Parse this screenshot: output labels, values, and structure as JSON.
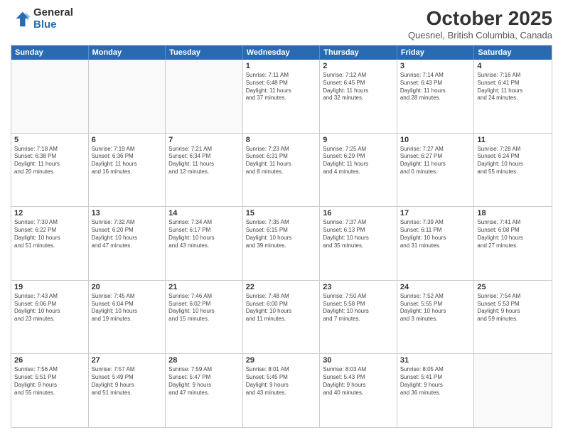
{
  "header": {
    "logo_general": "General",
    "logo_blue": "Blue",
    "month": "October 2025",
    "location": "Quesnel, British Columbia, Canada"
  },
  "days_of_week": [
    "Sunday",
    "Monday",
    "Tuesday",
    "Wednesday",
    "Thursday",
    "Friday",
    "Saturday"
  ],
  "weeks": [
    [
      {
        "day": "",
        "info": ""
      },
      {
        "day": "",
        "info": ""
      },
      {
        "day": "",
        "info": ""
      },
      {
        "day": "1",
        "info": "Sunrise: 7:11 AM\nSunset: 6:48 PM\nDaylight: 11 hours\nand 37 minutes."
      },
      {
        "day": "2",
        "info": "Sunrise: 7:12 AM\nSunset: 6:45 PM\nDaylight: 11 hours\nand 32 minutes."
      },
      {
        "day": "3",
        "info": "Sunrise: 7:14 AM\nSunset: 6:43 PM\nDaylight: 11 hours\nand 28 minutes."
      },
      {
        "day": "4",
        "info": "Sunrise: 7:16 AM\nSunset: 6:41 PM\nDaylight: 11 hours\nand 24 minutes."
      }
    ],
    [
      {
        "day": "5",
        "info": "Sunrise: 7:18 AM\nSunset: 6:38 PM\nDaylight: 11 hours\nand 20 minutes."
      },
      {
        "day": "6",
        "info": "Sunrise: 7:19 AM\nSunset: 6:36 PM\nDaylight: 11 hours\nand 16 minutes."
      },
      {
        "day": "7",
        "info": "Sunrise: 7:21 AM\nSunset: 6:34 PM\nDaylight: 11 hours\nand 12 minutes."
      },
      {
        "day": "8",
        "info": "Sunrise: 7:23 AM\nSunset: 6:31 PM\nDaylight: 11 hours\nand 8 minutes."
      },
      {
        "day": "9",
        "info": "Sunrise: 7:25 AM\nSunset: 6:29 PM\nDaylight: 11 hours\nand 4 minutes."
      },
      {
        "day": "10",
        "info": "Sunrise: 7:27 AM\nSunset: 6:27 PM\nDaylight: 11 hours\nand 0 minutes."
      },
      {
        "day": "11",
        "info": "Sunrise: 7:28 AM\nSunset: 6:24 PM\nDaylight: 10 hours\nand 55 minutes."
      }
    ],
    [
      {
        "day": "12",
        "info": "Sunrise: 7:30 AM\nSunset: 6:22 PM\nDaylight: 10 hours\nand 51 minutes."
      },
      {
        "day": "13",
        "info": "Sunrise: 7:32 AM\nSunset: 6:20 PM\nDaylight: 10 hours\nand 47 minutes."
      },
      {
        "day": "14",
        "info": "Sunrise: 7:34 AM\nSunset: 6:17 PM\nDaylight: 10 hours\nand 43 minutes."
      },
      {
        "day": "15",
        "info": "Sunrise: 7:35 AM\nSunset: 6:15 PM\nDaylight: 10 hours\nand 39 minutes."
      },
      {
        "day": "16",
        "info": "Sunrise: 7:37 AM\nSunset: 6:13 PM\nDaylight: 10 hours\nand 35 minutes."
      },
      {
        "day": "17",
        "info": "Sunrise: 7:39 AM\nSunset: 6:11 PM\nDaylight: 10 hours\nand 31 minutes."
      },
      {
        "day": "18",
        "info": "Sunrise: 7:41 AM\nSunset: 6:08 PM\nDaylight: 10 hours\nand 27 minutes."
      }
    ],
    [
      {
        "day": "19",
        "info": "Sunrise: 7:43 AM\nSunset: 6:06 PM\nDaylight: 10 hours\nand 23 minutes."
      },
      {
        "day": "20",
        "info": "Sunrise: 7:45 AM\nSunset: 6:04 PM\nDaylight: 10 hours\nand 19 minutes."
      },
      {
        "day": "21",
        "info": "Sunrise: 7:46 AM\nSunset: 6:02 PM\nDaylight: 10 hours\nand 15 minutes."
      },
      {
        "day": "22",
        "info": "Sunrise: 7:48 AM\nSunset: 6:00 PM\nDaylight: 10 hours\nand 11 minutes."
      },
      {
        "day": "23",
        "info": "Sunrise: 7:50 AM\nSunset: 5:58 PM\nDaylight: 10 hours\nand 7 minutes."
      },
      {
        "day": "24",
        "info": "Sunrise: 7:52 AM\nSunset: 5:55 PM\nDaylight: 10 hours\nand 3 minutes."
      },
      {
        "day": "25",
        "info": "Sunrise: 7:54 AM\nSunset: 5:53 PM\nDaylight: 9 hours\nand 59 minutes."
      }
    ],
    [
      {
        "day": "26",
        "info": "Sunrise: 7:56 AM\nSunset: 5:51 PM\nDaylight: 9 hours\nand 55 minutes."
      },
      {
        "day": "27",
        "info": "Sunrise: 7:57 AM\nSunset: 5:49 PM\nDaylight: 9 hours\nand 51 minutes."
      },
      {
        "day": "28",
        "info": "Sunrise: 7:59 AM\nSunset: 5:47 PM\nDaylight: 9 hours\nand 47 minutes."
      },
      {
        "day": "29",
        "info": "Sunrise: 8:01 AM\nSunset: 5:45 PM\nDaylight: 9 hours\nand 43 minutes."
      },
      {
        "day": "30",
        "info": "Sunrise: 8:03 AM\nSunset: 5:43 PM\nDaylight: 9 hours\nand 40 minutes."
      },
      {
        "day": "31",
        "info": "Sunrise: 8:05 AM\nSunset: 5:41 PM\nDaylight: 9 hours\nand 36 minutes."
      },
      {
        "day": "",
        "info": ""
      }
    ]
  ]
}
